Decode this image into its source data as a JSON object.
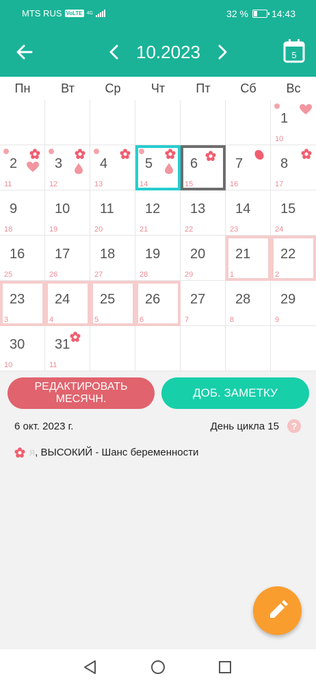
{
  "status_bar": {
    "carrier": "MTS RUS",
    "volte": "VoLTE",
    "network": "4G",
    "battery": "32 %",
    "battery_level": 0.32,
    "time": "14:43"
  },
  "header": {
    "title": "10.2023",
    "today_icon_label": "5"
  },
  "weekdays": [
    "Пн",
    "Вт",
    "Ср",
    "Чт",
    "Пт",
    "Сб",
    "Вс"
  ],
  "days": [
    {
      "day": "",
      "cycle": ""
    },
    {
      "day": "",
      "cycle": ""
    },
    {
      "day": "",
      "cycle": ""
    },
    {
      "day": "",
      "cycle": ""
    },
    {
      "day": "",
      "cycle": ""
    },
    {
      "day": "",
      "cycle": ""
    },
    {
      "day": "1",
      "cycle": "10",
      "icons": [
        "dot",
        "heart"
      ]
    },
    {
      "day": "2",
      "cycle": "11",
      "icons": [
        "dot",
        "flower",
        "heart-low"
      ]
    },
    {
      "day": "3",
      "cycle": "12",
      "icons": [
        "dot",
        "flower",
        "drop"
      ]
    },
    {
      "day": "4",
      "cycle": "13",
      "icons": [
        "dot",
        "flower"
      ]
    },
    {
      "day": "5",
      "cycle": "14",
      "icons": [
        "dot",
        "flower",
        "drop"
      ],
      "mark": "today"
    },
    {
      "day": "6",
      "cycle": "15",
      "icons": [
        "flower-left"
      ],
      "mark": "selected"
    },
    {
      "day": "7",
      "cycle": "16",
      "icons": [
        "egg"
      ]
    },
    {
      "day": "8",
      "cycle": "17",
      "icons": [
        "flower"
      ]
    },
    {
      "day": "9",
      "cycle": "18"
    },
    {
      "day": "10",
      "cycle": "19"
    },
    {
      "day": "11",
      "cycle": "20"
    },
    {
      "day": "12",
      "cycle": "21"
    },
    {
      "day": "13",
      "cycle": "22"
    },
    {
      "day": "14",
      "cycle": "23"
    },
    {
      "day": "15",
      "cycle": "24"
    },
    {
      "day": "16",
      "cycle": "25"
    },
    {
      "day": "17",
      "cycle": "26"
    },
    {
      "day": "18",
      "cycle": "27"
    },
    {
      "day": "19",
      "cycle": "28"
    },
    {
      "day": "20",
      "cycle": "29"
    },
    {
      "day": "21",
      "cycle": "1",
      "mark": "period"
    },
    {
      "day": "22",
      "cycle": "2",
      "mark": "period"
    },
    {
      "day": "23",
      "cycle": "3",
      "mark": "period"
    },
    {
      "day": "24",
      "cycle": "4",
      "mark": "period"
    },
    {
      "day": "25",
      "cycle": "5",
      "mark": "period"
    },
    {
      "day": "26",
      "cycle": "6",
      "mark": "period"
    },
    {
      "day": "27",
      "cycle": "7"
    },
    {
      "day": "28",
      "cycle": "8"
    },
    {
      "day": "29",
      "cycle": "9"
    },
    {
      "day": "30",
      "cycle": "10"
    },
    {
      "day": "31",
      "cycle": "11",
      "icons": [
        "flower-left"
      ]
    },
    {
      "day": "",
      "cycle": ""
    },
    {
      "day": "",
      "cycle": ""
    },
    {
      "day": "",
      "cycle": ""
    },
    {
      "day": "",
      "cycle": ""
    },
    {
      "day": "",
      "cycle": ""
    }
  ],
  "actions": {
    "edit_label_line1": "РЕДАКТИРОВАТЬ",
    "edit_label_line2": "МЕСЯЧН.",
    "note_label": "ДОБ. ЗАМЕТКУ"
  },
  "details": {
    "selected_date": "6 окт. 2023 г.",
    "cycle_day": "День цикла 15",
    "help": "?",
    "chance_prefix": "я",
    "chance_text": ", ВЫСОКИЙ - Шанс беременности"
  },
  "colors": {
    "primary": "#1ab398",
    "edit_button": "#e0636d",
    "note_button": "#17cfa9",
    "fab": "#f99d2e",
    "today_outline": "#27cdd0",
    "selected_outline": "#6e6e6e",
    "period_outline": "#f6cccc",
    "flower": "#ef5e70"
  },
  "icons": {
    "back": "arrow-left-icon",
    "prev": "chevron-left-icon",
    "next": "chevron-right-icon",
    "today": "calendar-icon",
    "fab": "pencil-icon",
    "fertility": "flower-icon"
  }
}
